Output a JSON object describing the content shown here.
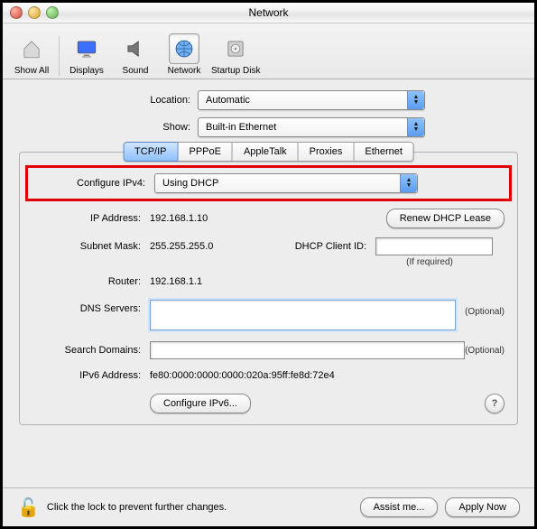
{
  "window": {
    "title": "Network"
  },
  "toolbar": {
    "items": [
      {
        "label": "Show All"
      },
      {
        "label": "Displays"
      },
      {
        "label": "Sound"
      },
      {
        "label": "Network"
      },
      {
        "label": "Startup Disk"
      }
    ]
  },
  "form": {
    "location_label": "Location:",
    "location_value": "Automatic",
    "show_label": "Show:",
    "show_value": "Built-in Ethernet"
  },
  "tabs": {
    "items": [
      "TCP/IP",
      "PPPoE",
      "AppleTalk",
      "Proxies",
      "Ethernet"
    ],
    "selected": "TCP/IP"
  },
  "tcpip": {
    "configure_label": "Configure IPv4:",
    "configure_value": "Using DHCP",
    "ip_label": "IP Address:",
    "ip_value": "192.168.1.10",
    "renew_btn": "Renew DHCP Lease",
    "subnet_label": "Subnet Mask:",
    "subnet_value": "255.255.255.0",
    "dhcp_client_label": "DHCP Client ID:",
    "dhcp_client_hint": "(If required)",
    "router_label": "Router:",
    "router_value": "192.168.1.1",
    "dns_label": "DNS Servers:",
    "dns_hint": "(Optional)",
    "search_label": "Search Domains:",
    "search_hint": "(Optional)",
    "ipv6addr_label": "IPv6 Address:",
    "ipv6addr_value": "fe80:0000:0000:0000:020a:95ff:fe8d:72e4",
    "configure_ipv6_btn": "Configure IPv6...",
    "help": "?"
  },
  "footer": {
    "lock_text": "Click the lock to prevent further changes.",
    "assist_btn": "Assist me...",
    "apply_btn": "Apply Now"
  }
}
